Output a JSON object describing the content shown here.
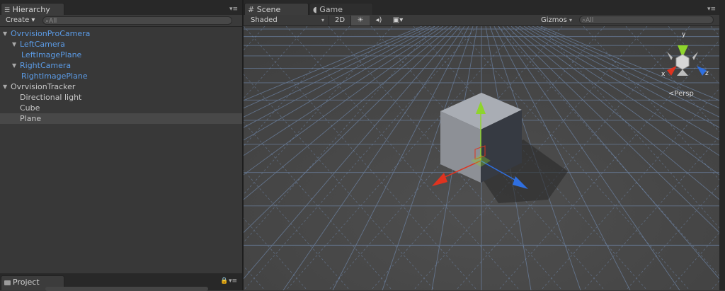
{
  "hierarchy": {
    "title": "Hierarchy",
    "create_label": "Create ▾",
    "search_placeholder": "All",
    "items": [
      {
        "label": "OvrvisionProCamera",
        "depth": 0,
        "expanded": true,
        "color": "#5b9be6"
      },
      {
        "label": "LeftCamera",
        "depth": 1,
        "expanded": true,
        "color": "#5b9be6"
      },
      {
        "label": "LeftImagePlane",
        "depth": 2,
        "expanded": false,
        "color": "#5b9be6"
      },
      {
        "label": "RightCamera",
        "depth": 1,
        "expanded": true,
        "color": "#5b9be6"
      },
      {
        "label": "RightImagePlane",
        "depth": 2,
        "expanded": false,
        "color": "#5b9be6"
      },
      {
        "label": "OvrvisionTracker",
        "depth": 0,
        "expanded": true,
        "color": "#c8c8c8"
      },
      {
        "label": "Directional light",
        "depth": 1,
        "expanded": false,
        "color": "#c8c8c8"
      },
      {
        "label": "Cube",
        "depth": 1,
        "expanded": false,
        "color": "#c8c8c8"
      },
      {
        "label": "Plane",
        "depth": 1,
        "expanded": false,
        "color": "#c8c8c8",
        "selected": true
      }
    ]
  },
  "project": {
    "title": "Project"
  },
  "scene": {
    "tabs": [
      {
        "label": "Scene",
        "active": true
      },
      {
        "label": "Game",
        "active": false
      }
    ],
    "shading_mode": "Shaded",
    "mode_2d": "2D",
    "gizmos_label": "Gizmos",
    "search_placeholder": "All",
    "projection_label": "Persp",
    "axis_labels": {
      "x": "x",
      "y": "y",
      "z": "z"
    }
  },
  "colors": {
    "selection_blue": "#5b9be6",
    "axis_x": "#e0331f",
    "axis_y": "#8ed42c",
    "axis_z": "#2f6fe0",
    "grid_line": "#7a98c4"
  },
  "icons": [
    "hierarchy-list-icon",
    "panel-menu-icon",
    "search-icon",
    "expand-arrow-icon",
    "folder-icon",
    "lock-icon",
    "scene-grid-icon",
    "game-controller-icon",
    "lighting-icon",
    "audio-icon",
    "effects-icon"
  ]
}
